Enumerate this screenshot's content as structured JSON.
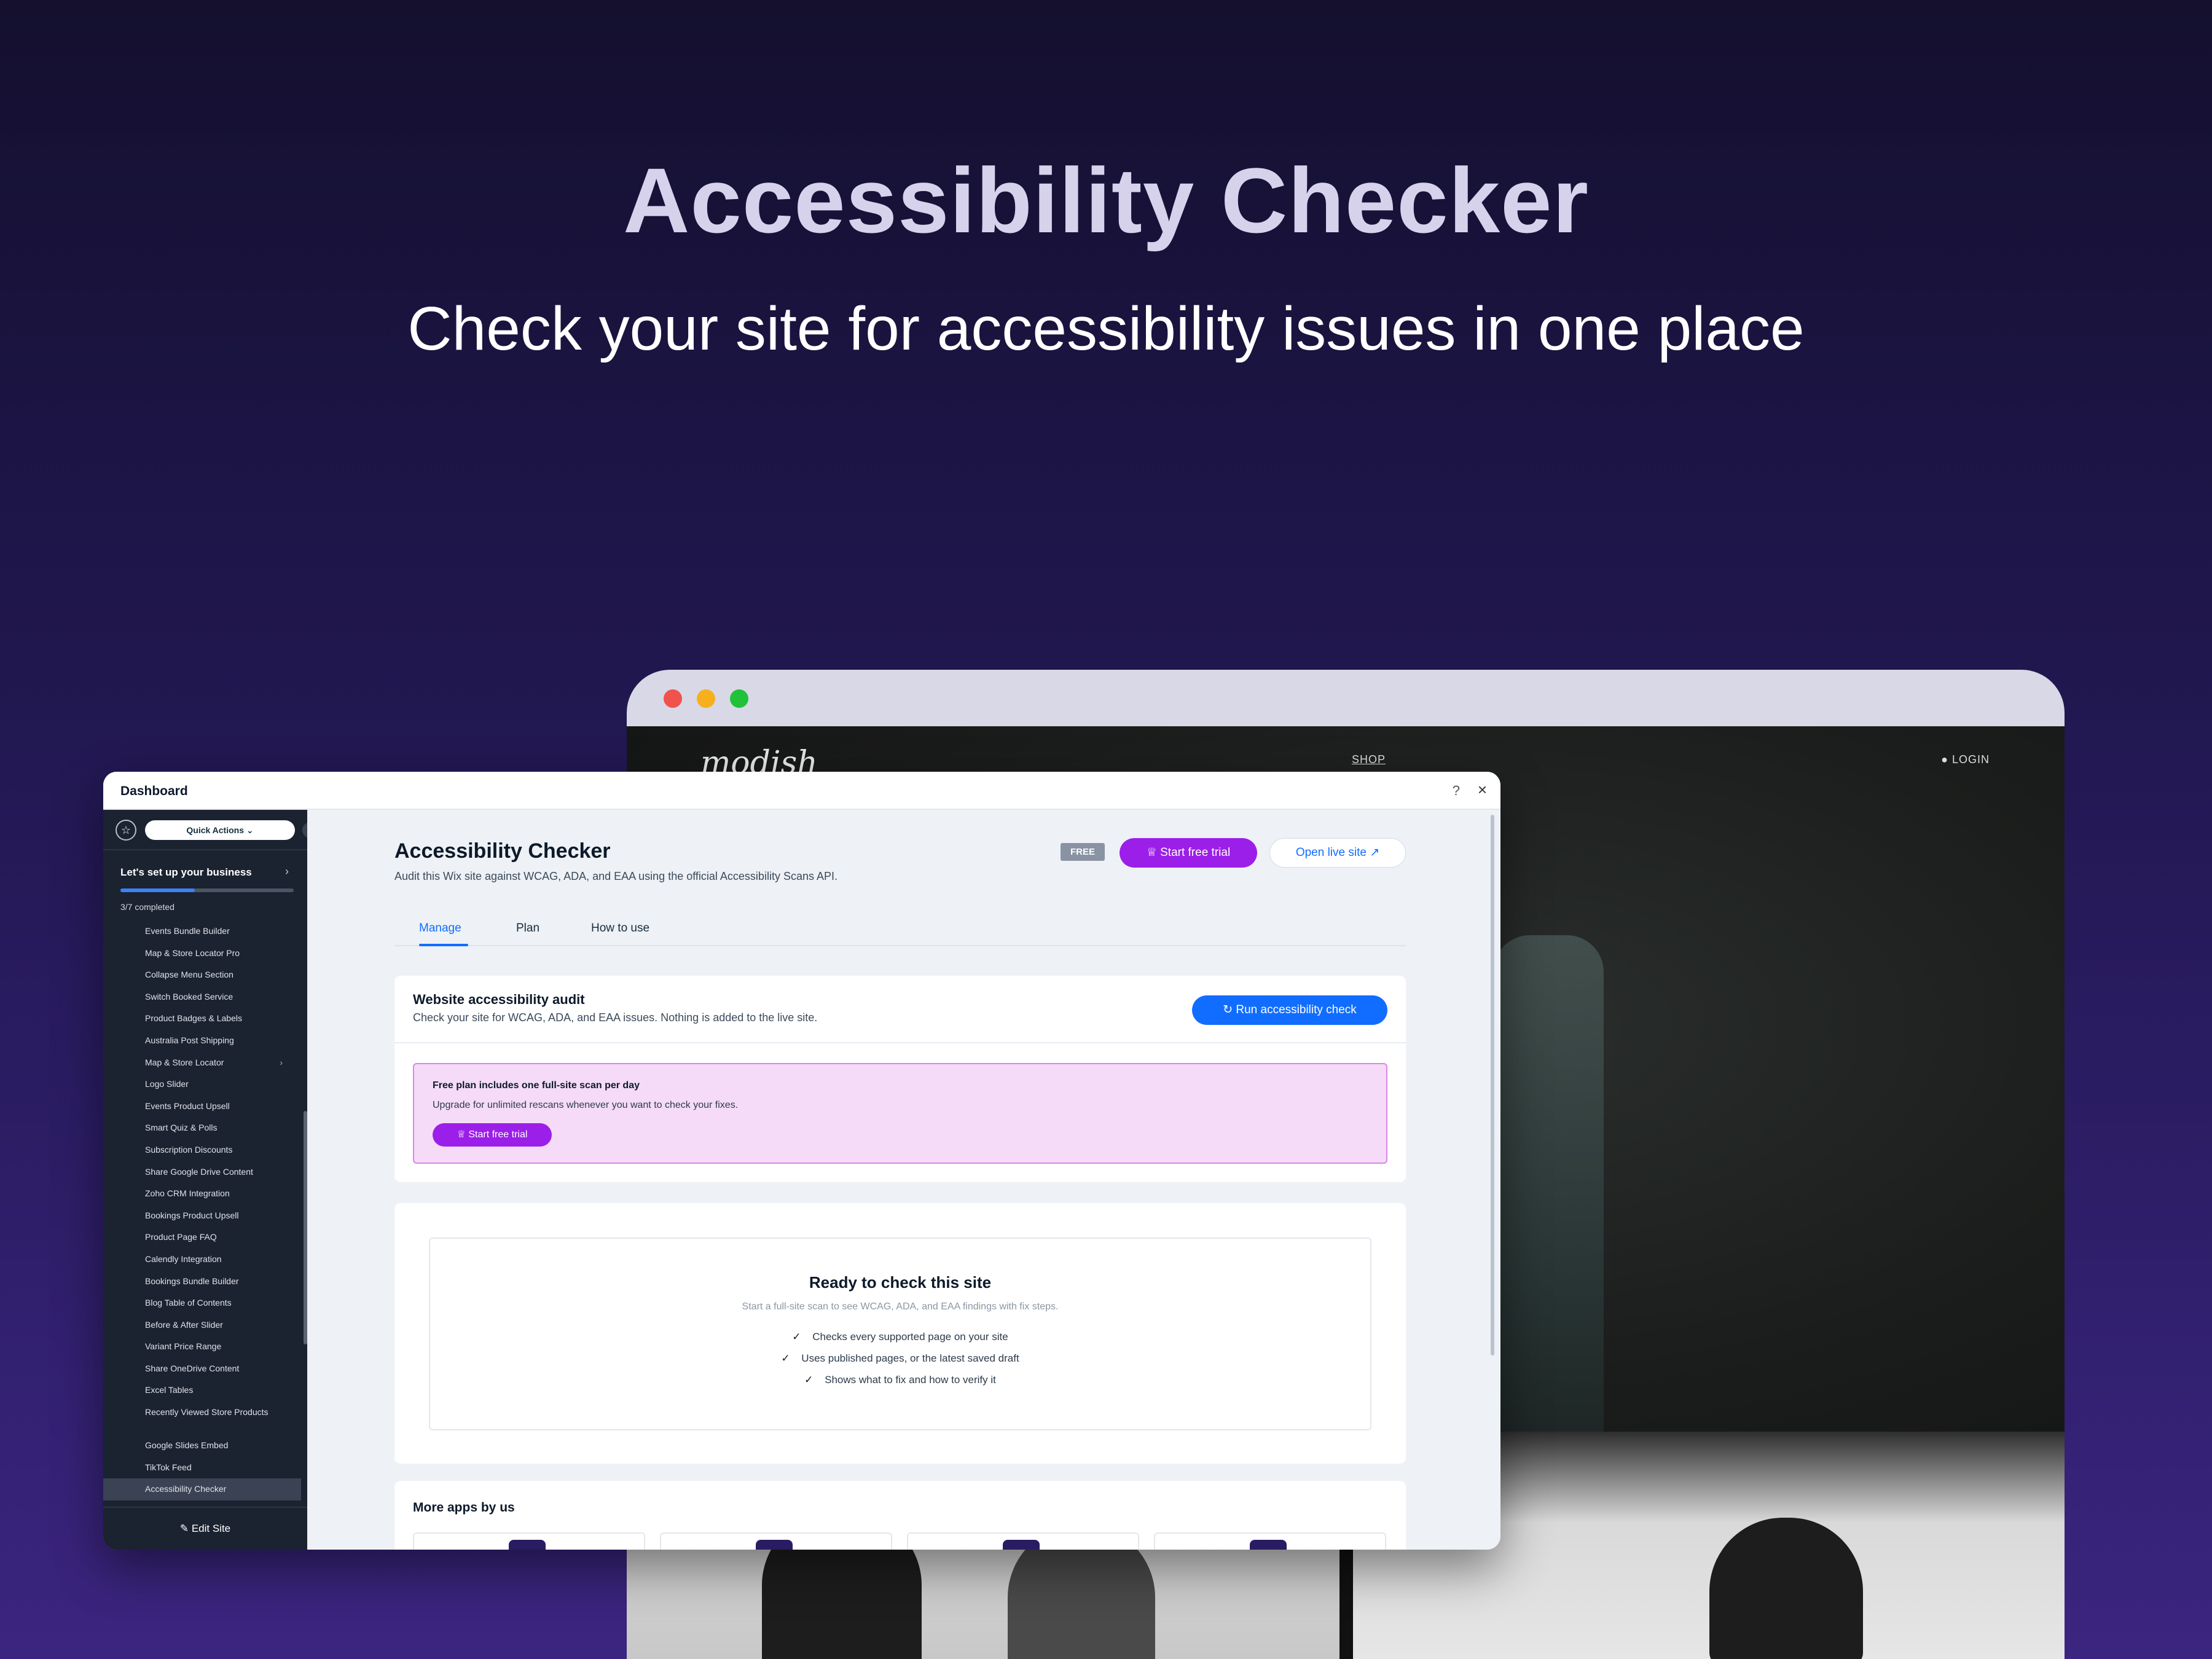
{
  "hero": {
    "title": "Accessibility Checker",
    "subtitle": "Check your site for accessibility issues in one place"
  },
  "site": {
    "logo": "modish",
    "nav_shop": "SHOP",
    "nav_login": "LOGIN"
  },
  "window": {
    "title": "Dashboard",
    "help": "?",
    "close": "×"
  },
  "sidebar": {
    "quick_actions": "Quick Actions",
    "setup_title": "Let's set up your business",
    "setup_progress": 0.43,
    "setup_completed": "3/7 completed",
    "items": [
      {
        "label": "Events Bundle Builder"
      },
      {
        "label": "Map & Store Locator Pro"
      },
      {
        "label": "Collapse Menu Section"
      },
      {
        "label": "Switch Booked Service"
      },
      {
        "label": "Product Badges & Labels"
      },
      {
        "label": "Australia Post Shipping"
      },
      {
        "label": "Map & Store Locator"
      },
      {
        "label": "Logo Slider"
      },
      {
        "label": "Events Product Upsell"
      },
      {
        "label": "Smart Quiz & Polls"
      },
      {
        "label": "Subscription Discounts"
      },
      {
        "label": "Share Google Drive Content"
      },
      {
        "label": "Zoho CRM Integration"
      },
      {
        "label": "Bookings Product Upsell"
      },
      {
        "label": "Product Page FAQ"
      },
      {
        "label": "Calendly Integration"
      },
      {
        "label": "Bookings Bundle Builder"
      },
      {
        "label": "Blog Table of Contents"
      },
      {
        "label": "Before & After Slider"
      },
      {
        "label": "Variant Price Range"
      },
      {
        "label": "Share OneDrive Content"
      },
      {
        "label": "Excel Tables"
      },
      {
        "label": "Recently Viewed Store Products"
      },
      {
        "label": "Google Slides Embed"
      },
      {
        "label": "TikTok Feed"
      },
      {
        "label": "Accessibility Checker"
      }
    ],
    "edit_site": "Edit Site"
  },
  "main": {
    "title": "Accessibility Checker",
    "description": "Audit this Wix site against WCAG, ADA, and EAA using the official Accessibility Scans API.",
    "badge": "FREE",
    "trial_button": "Start free trial",
    "live_button": "Open live site",
    "tabs": [
      {
        "label": "Manage"
      },
      {
        "label": "Plan"
      },
      {
        "label": "How to use"
      }
    ],
    "audit": {
      "title": "Website accessibility audit",
      "description": "Check your site for WCAG, ADA, and EAA issues. Nothing is added to the live site.",
      "run_button": "Run accessibility check"
    },
    "upsell": {
      "title": "Free plan includes one full-site scan per day",
      "description": "Upgrade for unlimited rescans whenever you want to check your fixes.",
      "button": "Start free trial"
    },
    "ready": {
      "title": "Ready to check this site",
      "description": "Start a full-site scan to see WCAG, ADA, and EAA findings with fix steps.",
      "items": [
        {
          "label": "Checks every supported page on your site"
        },
        {
          "label": "Uses published pages, or the latest saved draft"
        },
        {
          "label": "Shows what to fix and how to verify it"
        }
      ]
    },
    "more_apps": {
      "title": "More apps by us"
    }
  },
  "colors": {
    "accent_blue": "#116dff",
    "accent_purple": "#9b1fe8",
    "sidebar_bg": "#1b2230"
  }
}
